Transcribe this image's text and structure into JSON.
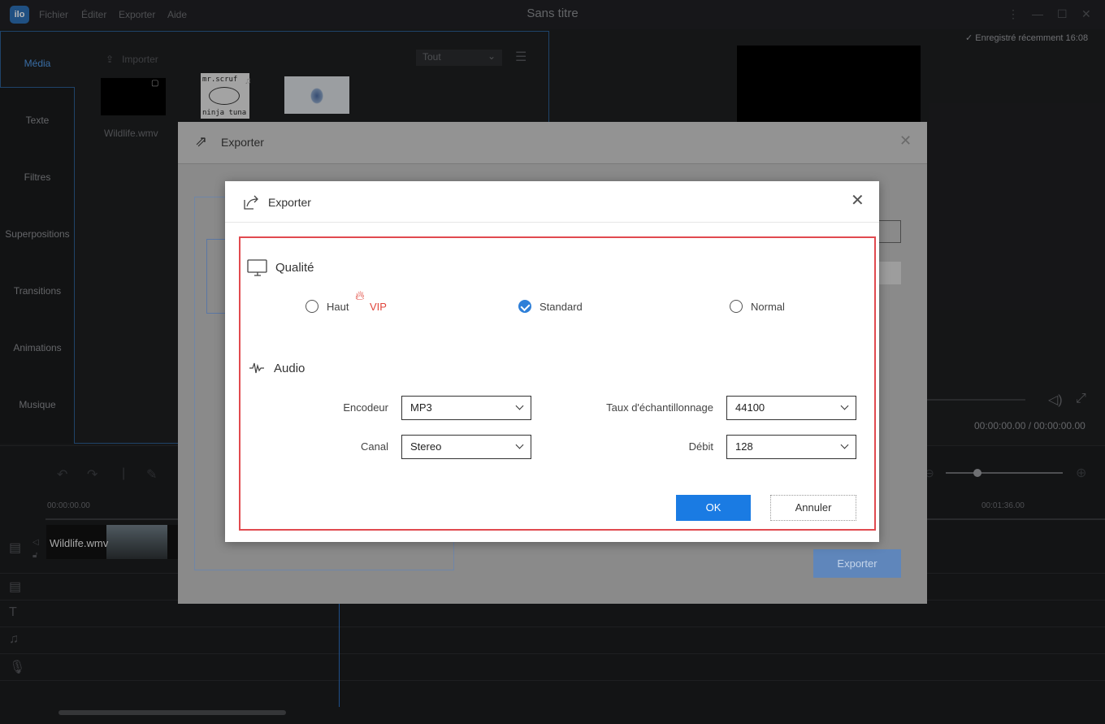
{
  "app": {
    "logo_text": "ilo",
    "title": "Sans titre",
    "menu": [
      "Fichier",
      "Éditer",
      "Exporter",
      "Aide"
    ],
    "saved_status": "Enregistré récemment 16:08"
  },
  "sidebar": {
    "items": [
      "Média",
      "Texte",
      "Filtres",
      "Superpositions",
      "Transitions",
      "Animations",
      "Musique"
    ]
  },
  "media": {
    "import_label": "Importer",
    "filter_value": "Tout",
    "thumb_name": "Wildlife.wmv",
    "thumb2_text_top": "mr.scruf",
    "thumb2_text_bottom": "ninja tuna"
  },
  "player": {
    "time_readout": "00:00:00.00 / 00:00:00.00"
  },
  "timeline": {
    "start_time": "00:00:00.00",
    "end_time": "00:01:36.00",
    "clip_name": "Wildlife.wmv"
  },
  "export_dialog_back": {
    "title": "Exporter",
    "export_button": "Exporter"
  },
  "export_dialog": {
    "title": "Exporter",
    "quality": {
      "title": "Qualité",
      "options": [
        "Haut",
        "Standard",
        "Normal"
      ],
      "vip_badge": "VIP",
      "selected": "Standard"
    },
    "audio": {
      "title": "Audio",
      "encoder_label": "Encodeur",
      "encoder_value": "MP3",
      "sample_rate_label": "Taux d'échantillonnage",
      "sample_rate_value": "44100",
      "channel_label": "Canal",
      "channel_value": "Stereo",
      "bitrate_label": "Débit",
      "bitrate_value": "128"
    },
    "ok_button": "OK",
    "cancel_button": "Annuler",
    "highlight_color": "#e14a4f",
    "accent_color": "#1a7be3"
  }
}
